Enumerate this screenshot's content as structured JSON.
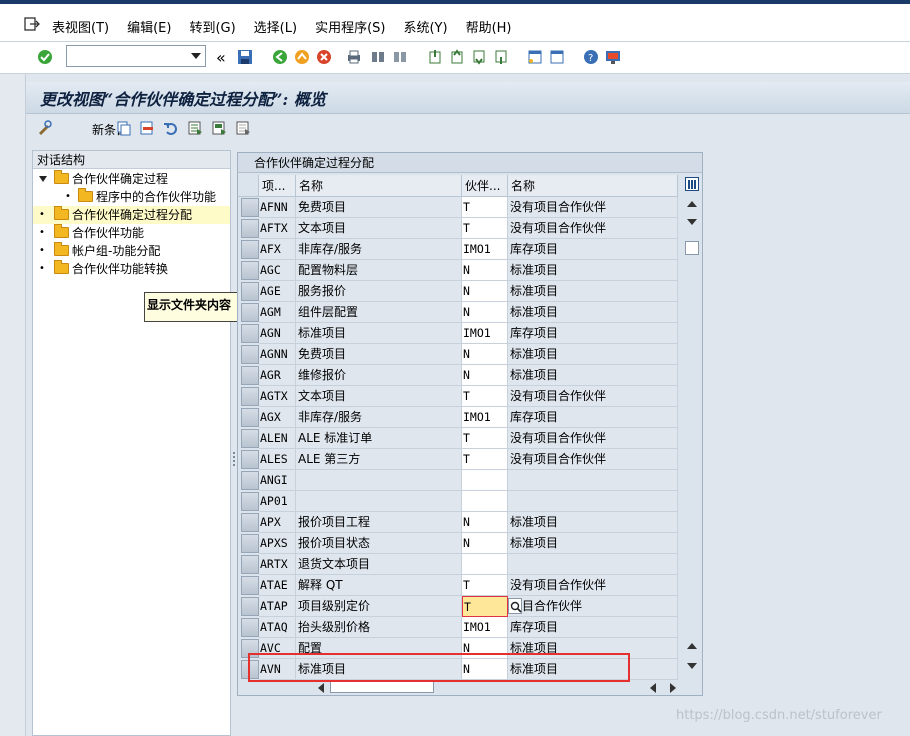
{
  "menu": {
    "items": [
      "表视图(T)",
      "编辑(E)",
      "转到(G)",
      "选择(L)",
      "实用程序(S)",
      "系统(Y)",
      "帮助(H)"
    ]
  },
  "toolbar": {
    "command_value": "",
    "back_label": "«"
  },
  "screen": {
    "title": "更改视图“合作伙伴确定过程分配”: 概览",
    "new_entries_label": "新条目"
  },
  "dialog_structure": {
    "header": "对话结构",
    "items": [
      {
        "label": "合作伙伴确定过程",
        "level": 0,
        "expanded": true,
        "selected": false
      },
      {
        "label": "程序中的合作伙伴功能",
        "level": 1,
        "expanded": false,
        "selected": false
      },
      {
        "label": "合作伙伴确定过程分配",
        "level": 0,
        "expanded": false,
        "selected": true
      },
      {
        "label": "合作伙伴功能",
        "level": 0,
        "expanded": false,
        "selected": false
      },
      {
        "label": "帐户组-功能分配",
        "level": 0,
        "expanded": false,
        "selected": false
      },
      {
        "label": "合作伙伴功能转换",
        "level": 0,
        "expanded": false,
        "selected": false
      }
    ],
    "tooltip": "显示文件夹内容"
  },
  "table": {
    "title": "合作伙伴确定过程分配",
    "columns": [
      "项...",
      "名称",
      "伙伴...",
      "名称"
    ],
    "rows": [
      {
        "key": "AFNN",
        "name": "免费项目",
        "proc": "T",
        "proc_name": "没有项目合作伙伴"
      },
      {
        "key": "AFTX",
        "name": "文本项目",
        "proc": "T",
        "proc_name": "没有项目合作伙伴"
      },
      {
        "key": "AFX",
        "name": "非库存/服务",
        "proc": "IMO1",
        "proc_name": "库存项目"
      },
      {
        "key": "AGC",
        "name": "配置物料层",
        "proc": "N",
        "proc_name": "标准项目"
      },
      {
        "key": "AGE",
        "name": "服务报价",
        "proc": "N",
        "proc_name": "标准项目"
      },
      {
        "key": "AGM",
        "name": "组件层配置",
        "proc": "N",
        "proc_name": "标准项目"
      },
      {
        "key": "AGN",
        "name": "标准项目",
        "proc": "IMO1",
        "proc_name": "库存项目"
      },
      {
        "key": "AGNN",
        "name": "免费项目",
        "proc": "N",
        "proc_name": "标准项目"
      },
      {
        "key": "AGR",
        "name": "维修报价",
        "proc": "N",
        "proc_name": "标准项目"
      },
      {
        "key": "AGTX",
        "name": "文本项目",
        "proc": "T",
        "proc_name": "没有项目合作伙伴"
      },
      {
        "key": "AGX",
        "name": "非库存/服务",
        "proc": "IMO1",
        "proc_name": "库存项目"
      },
      {
        "key": "ALEN",
        "name": "ALE 标准订单",
        "proc": "T",
        "proc_name": "没有项目合作伙伴"
      },
      {
        "key": "ALES",
        "name": "ALE 第三方",
        "proc": "T",
        "proc_name": "没有项目合作伙伴"
      },
      {
        "key": "ANGI",
        "name": "",
        "proc": "",
        "proc_name": ""
      },
      {
        "key": "AP01",
        "name": "",
        "proc": "",
        "proc_name": ""
      },
      {
        "key": "APX",
        "name": "报价项目工程",
        "proc": "N",
        "proc_name": "标准项目"
      },
      {
        "key": "APXS",
        "name": "报价项目状态",
        "proc": "N",
        "proc_name": "标准项目"
      },
      {
        "key": "ARTX",
        "name": "退货文本项目",
        "proc": "",
        "proc_name": ""
      },
      {
        "key": "ATAE",
        "name": "解释 QT",
        "proc": "T",
        "proc_name": "没有项目合作伙伴"
      },
      {
        "key": "ATAP",
        "name": "项目级别定价",
        "proc": "T",
        "proc_name": "项目合作伙伴",
        "focus": true
      },
      {
        "key": "ATAQ",
        "name": "抬头级别价格",
        "proc": "IMO1",
        "proc_name": "库存项目"
      },
      {
        "key": "AVC",
        "name": "配置",
        "proc": "N",
        "proc_name": "标准项目"
      },
      {
        "key": "AVN",
        "name": "标准项目",
        "proc": "N",
        "proc_name": "标准项目"
      }
    ]
  },
  "watermark": "https://blog.csdn.net/stuforever",
  "colors": {
    "title_bar": "#cdd9e5",
    "selected_tree": "#fffbc8",
    "focus_cell": "#ffe79a",
    "highlight_box": "#e53030"
  }
}
